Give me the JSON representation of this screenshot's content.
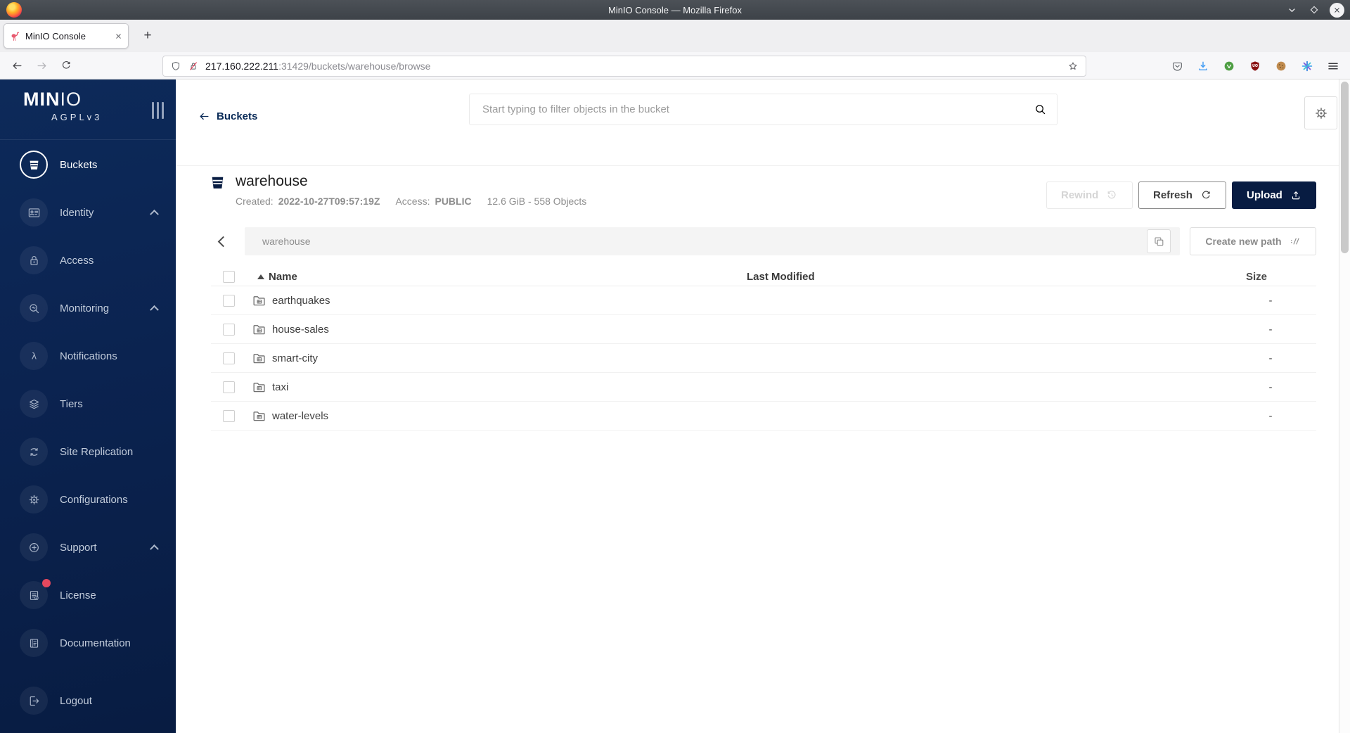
{
  "browser": {
    "window_title": "MinIO Console — Mozilla Firefox",
    "tab_title": "MinIO Console",
    "new_tab_label": "+",
    "url": {
      "host": "217.160.222.211",
      "rest": ":31429/buckets/warehouse/browse"
    }
  },
  "sidebar": {
    "logo_primary": "MIN",
    "logo_secondary": "IO",
    "license_tag": "AGPLv3",
    "items": [
      {
        "label": "Buckets",
        "icon": "buckets-icon",
        "active": true
      },
      {
        "label": "Identity",
        "icon": "identity-icon",
        "chevron": true
      },
      {
        "label": "Access",
        "icon": "access-icon"
      },
      {
        "label": "Monitoring",
        "icon": "monitoring-icon",
        "chevron": true
      },
      {
        "label": "Notifications",
        "icon": "notifications-icon"
      },
      {
        "label": "Tiers",
        "icon": "tiers-icon"
      },
      {
        "label": "Site Replication",
        "icon": "site-replication-icon"
      },
      {
        "label": "Configurations",
        "icon": "configurations-icon"
      },
      {
        "label": "Support",
        "icon": "support-icon",
        "chevron": true
      },
      {
        "label": "License",
        "icon": "license-icon",
        "badge": true
      },
      {
        "label": "Documentation",
        "icon": "documentation-icon"
      },
      {
        "label": "Logout",
        "icon": "logout-icon",
        "gap": true
      }
    ]
  },
  "header": {
    "back_label": "Buckets",
    "search_placeholder": "Start typing to filter objects in the bucket"
  },
  "bucket": {
    "name": "warehouse",
    "created_label": "Created:",
    "created_value": "2022-10-27T09:57:19Z",
    "access_label": "Access:",
    "access_value": "PUBLIC",
    "stats": "12.6 GiB - 558 Objects",
    "actions": {
      "rewind": "Rewind",
      "refresh": "Refresh",
      "upload": "Upload"
    }
  },
  "pathbar": {
    "current_path": "warehouse",
    "create_button": "Create new path"
  },
  "table": {
    "headers": {
      "name": "Name",
      "last_modified": "Last Modified",
      "size": "Size"
    },
    "rows": [
      {
        "name": "earthquakes",
        "last_modified": "",
        "size": "-"
      },
      {
        "name": "house-sales",
        "last_modified": "",
        "size": "-"
      },
      {
        "name": "smart-city",
        "last_modified": "",
        "size": "-"
      },
      {
        "name": "taxi",
        "last_modified": "",
        "size": "-"
      },
      {
        "name": "water-levels",
        "last_modified": "",
        "size": "-"
      }
    ]
  },
  "colors": {
    "brand_navy": "#081C42",
    "sidebar_bg": "#0B2350",
    "badge_red": "#E5485E",
    "insecure_red": "#E2334F",
    "download_blue": "#3F9BF4"
  }
}
